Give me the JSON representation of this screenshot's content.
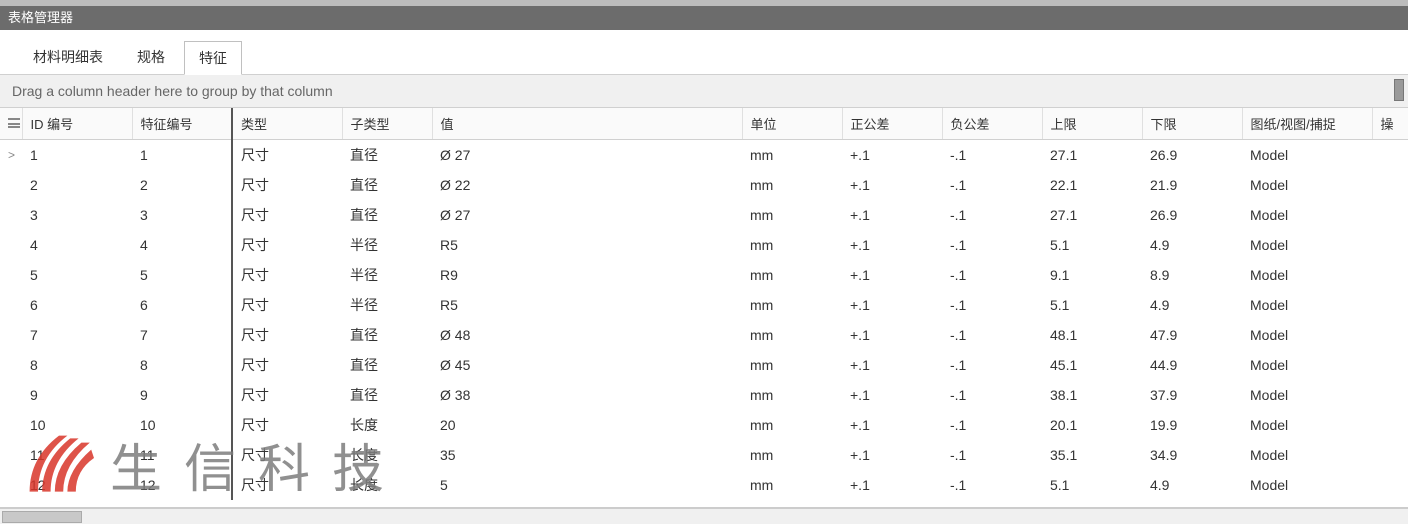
{
  "window": {
    "title": "表格管理器"
  },
  "tabs": [
    {
      "label": "材料明细表",
      "active": false
    },
    {
      "label": "规格",
      "active": false
    },
    {
      "label": "特征",
      "active": true
    }
  ],
  "group_hint": "Drag a column header here to group by that column",
  "columns": {
    "id": "ID 编号",
    "feat_num": "特征编号",
    "type": "类型",
    "subtype": "子类型",
    "value": "值",
    "unit": "单位",
    "pos_tol": "正公差",
    "neg_tol": "负公差",
    "upper": "上限",
    "lower": "下限",
    "drawing": "图纸/视图/捕捉",
    "op": "操"
  },
  "rows": [
    {
      "id": "1",
      "feat": "1",
      "type": "尺寸",
      "sub": "直径",
      "val": "Ø 27",
      "unit": "mm",
      "ptol": "+.1",
      "ntol": "-.1",
      "upper": "27.1",
      "lower": "26.9",
      "draw": "Model"
    },
    {
      "id": "2",
      "feat": "2",
      "type": "尺寸",
      "sub": "直径",
      "val": "Ø 22",
      "unit": "mm",
      "ptol": "+.1",
      "ntol": "-.1",
      "upper": "22.1",
      "lower": "21.9",
      "draw": "Model"
    },
    {
      "id": "3",
      "feat": "3",
      "type": "尺寸",
      "sub": "直径",
      "val": "Ø 27",
      "unit": "mm",
      "ptol": "+.1",
      "ntol": "-.1",
      "upper": "27.1",
      "lower": "26.9",
      "draw": "Model"
    },
    {
      "id": "4",
      "feat": "4",
      "type": "尺寸",
      "sub": "半径",
      "val": "R5",
      "unit": "mm",
      "ptol": "+.1",
      "ntol": "-.1",
      "upper": "5.1",
      "lower": "4.9",
      "draw": "Model"
    },
    {
      "id": "5",
      "feat": "5",
      "type": "尺寸",
      "sub": "半径",
      "val": "R9",
      "unit": "mm",
      "ptol": "+.1",
      "ntol": "-.1",
      "upper": "9.1",
      "lower": "8.9",
      "draw": "Model"
    },
    {
      "id": "6",
      "feat": "6",
      "type": "尺寸",
      "sub": "半径",
      "val": "R5",
      "unit": "mm",
      "ptol": "+.1",
      "ntol": "-.1",
      "upper": "5.1",
      "lower": "4.9",
      "draw": "Model"
    },
    {
      "id": "7",
      "feat": "7",
      "type": "尺寸",
      "sub": "直径",
      "val": "Ø 48",
      "unit": "mm",
      "ptol": "+.1",
      "ntol": "-.1",
      "upper": "48.1",
      "lower": "47.9",
      "draw": "Model"
    },
    {
      "id": "8",
      "feat": "8",
      "type": "尺寸",
      "sub": "直径",
      "val": "Ø 45",
      "unit": "mm",
      "ptol": "+.1",
      "ntol": "-.1",
      "upper": "45.1",
      "lower": "44.9",
      "draw": "Model"
    },
    {
      "id": "9",
      "feat": "9",
      "type": "尺寸",
      "sub": "直径",
      "val": "Ø 38",
      "unit": "mm",
      "ptol": "+.1",
      "ntol": "-.1",
      "upper": "38.1",
      "lower": "37.9",
      "draw": "Model"
    },
    {
      "id": "10",
      "feat": "10",
      "type": "尺寸",
      "sub": "长度",
      "val": "20",
      "unit": "mm",
      "ptol": "+.1",
      "ntol": "-.1",
      "upper": "20.1",
      "lower": "19.9",
      "draw": "Model"
    },
    {
      "id": "11",
      "feat": "11",
      "type": "尺寸",
      "sub": "长度",
      "val": "35",
      "unit": "mm",
      "ptol": "+.1",
      "ntol": "-.1",
      "upper": "35.1",
      "lower": "34.9",
      "draw": "Model"
    },
    {
      "id": "12",
      "feat": "12",
      "type": "尺寸",
      "sub": "长度",
      "val": "5",
      "unit": "mm",
      "ptol": "+.1",
      "ntol": "-.1",
      "upper": "5.1",
      "lower": "4.9",
      "draw": "Model"
    }
  ],
  "watermark": {
    "text": "生信科技"
  }
}
